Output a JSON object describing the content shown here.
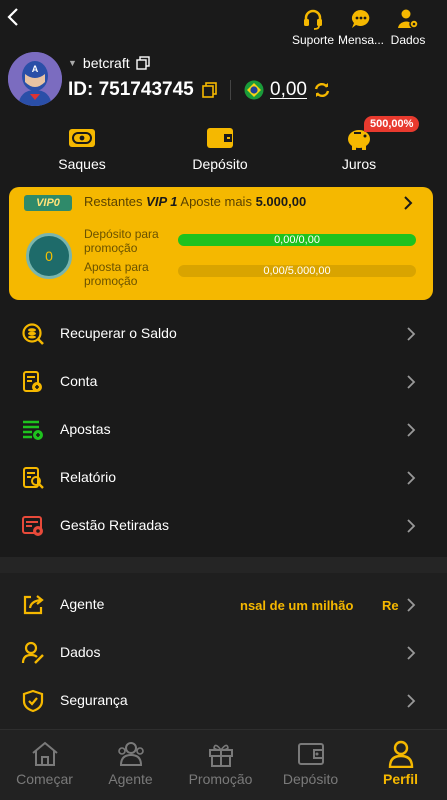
{
  "header": {
    "top_actions": [
      {
        "label": "Suporte",
        "icon": "headset-icon"
      },
      {
        "label": "Mensa...",
        "icon": "chat-icon"
      },
      {
        "label": "Dados",
        "icon": "user-gear-icon"
      }
    ]
  },
  "profile": {
    "username": "betcraft",
    "id_text": "ID: 751743745",
    "balance": "0,00",
    "currency_flag": "brazil-flag-icon"
  },
  "quick_actions": [
    {
      "label": "Saques",
      "icon": "withdraw-icon"
    },
    {
      "label": "Depósito",
      "icon": "wallet-icon"
    },
    {
      "label": "Juros",
      "icon": "piggy-bank-icon",
      "badge": "500,00%"
    }
  ],
  "vip": {
    "tag": "VIP0",
    "remaining_label": "Restantes",
    "level": "VIP 1",
    "bet_more_label": "Aposte mais",
    "bet_more_value": "5.000,00",
    "medal_level": "0",
    "rows": [
      {
        "label": "Depósito para promoção",
        "value": "0,00/0,00",
        "fill": 1.0
      },
      {
        "label": "Aposta para promoção",
        "value": "0,00/5.000,00",
        "fill": 0.0
      }
    ]
  },
  "menu_items": [
    {
      "label": "Recuperar o Saldo",
      "icon": "recover-balance-icon"
    },
    {
      "label": "Conta",
      "icon": "account-icon"
    },
    {
      "label": "Apostas",
      "icon": "bets-icon"
    },
    {
      "label": "Relatório",
      "icon": "report-icon"
    },
    {
      "label": "Gestão Retiradas",
      "icon": "withdraw-management-icon"
    }
  ],
  "lower_items": [
    {
      "label": "Agente",
      "icon": "share-icon",
      "marquee": "nsal de um milhão",
      "marquee_tail": "Re"
    },
    {
      "label": "Dados",
      "icon": "user-edit-icon"
    },
    {
      "label": "Segurança",
      "icon": "shield-icon"
    }
  ],
  "tabs": [
    {
      "label": "Começar",
      "icon": "home-icon"
    },
    {
      "label": "Agente",
      "icon": "agent-icon"
    },
    {
      "label": "Promoção",
      "icon": "gift-icon"
    },
    {
      "label": "Depósito",
      "icon": "wallet-tab-icon"
    },
    {
      "label": "Perfil",
      "icon": "profile-icon",
      "active": true
    }
  ],
  "colors": {
    "accent": "#f5b800",
    "progress_green": "#1ec21e",
    "badge_red": "#e83a2e"
  }
}
